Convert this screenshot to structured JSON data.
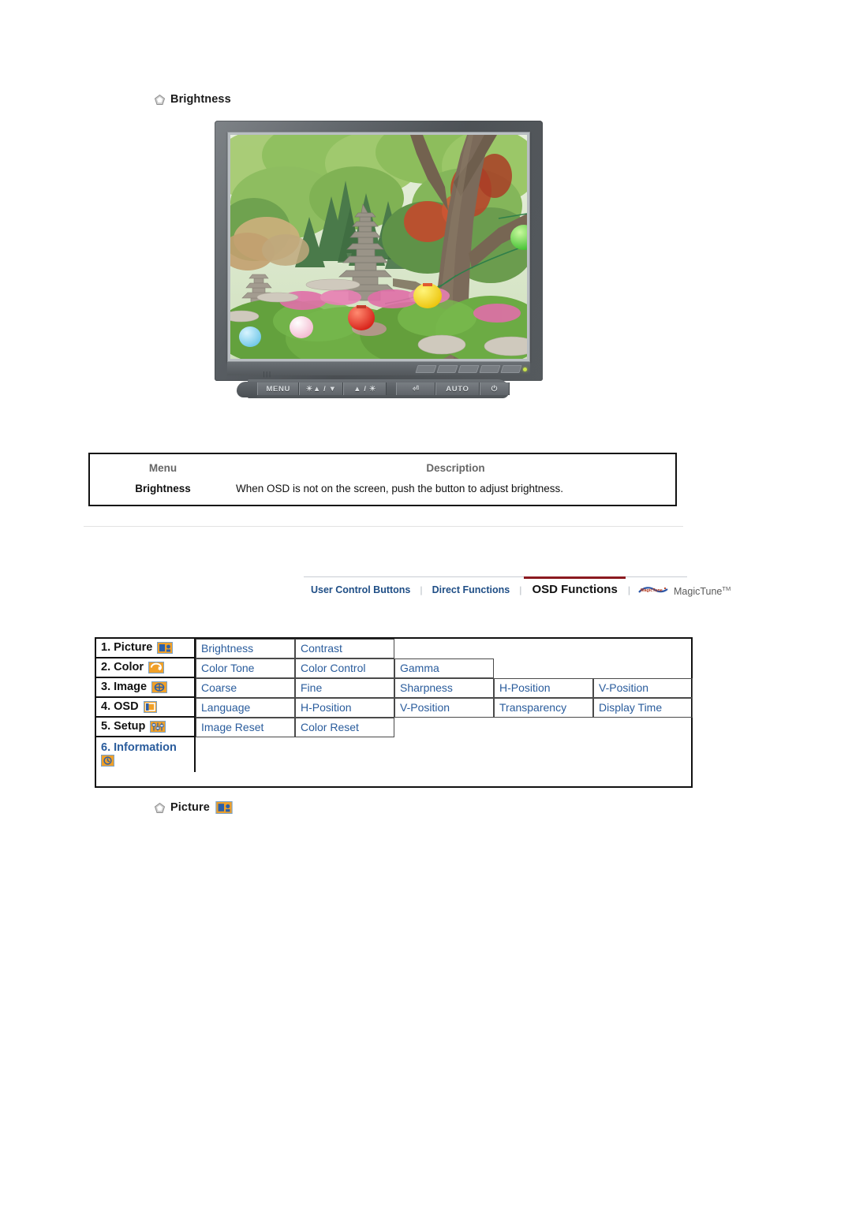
{
  "sections": {
    "brightness_heading": "Brightness",
    "picture_heading": "Picture"
  },
  "desc_table": {
    "headers": {
      "menu": "Menu",
      "description": "Description"
    },
    "rows": [
      {
        "menu": "Brightness",
        "description": "When OSD is not on the screen, push the button to adjust brightness."
      }
    ]
  },
  "monitor": {
    "buttons": [
      {
        "label": "MENU",
        "name": "menu-button"
      },
      {
        "label": "☀▲ / ▼",
        "name": "down-brightness-button"
      },
      {
        "label": "▲ / ☀",
        "name": "up-brightness-button"
      },
      {
        "label": "⏎",
        "name": "enter-button"
      },
      {
        "label": "AUTO",
        "name": "auto-button"
      },
      {
        "label": "⏻",
        "name": "power-button"
      }
    ]
  },
  "tabnav": {
    "tabs": [
      {
        "label": "User Control Buttons",
        "active": false
      },
      {
        "label": "Direct Functions",
        "active": false
      },
      {
        "label": "OSD Functions",
        "active": true
      }
    ],
    "separator": "❘",
    "magictune_label": "MagicTune",
    "magictune_tm": "TM",
    "active_underline_color": "#8b1a20",
    "link_color": "#1f4e86"
  },
  "osd_table": {
    "rows": [
      {
        "label": "1. Picture",
        "icon": "picture-icon",
        "items": [
          "Brightness",
          "Contrast"
        ]
      },
      {
        "label": "2. Color",
        "icon": "color-icon",
        "items": [
          "Color Tone",
          "Color Control",
          "Gamma"
        ]
      },
      {
        "label": "3. Image",
        "icon": "image-icon",
        "items": [
          "Coarse",
          "Fine",
          "Sharpness",
          "H-Position",
          "V-Position"
        ]
      },
      {
        "label": "4. OSD",
        "icon": "osd-icon",
        "items": [
          "Language",
          "H-Position",
          "V-Position",
          "Transparency",
          "Display Time"
        ]
      },
      {
        "label": "5. Setup",
        "icon": "setup-icon",
        "items": [
          "Image Reset",
          "Color Reset"
        ]
      },
      {
        "label": "6. Information",
        "icon": "information-icon",
        "items": []
      }
    ],
    "link_color": "#2a5c9c"
  },
  "colors": {
    "icon_orange": "#f0a028",
    "icon_border": "#7aa2c8",
    "bezel": "#b9bec2",
    "case": "#63686d"
  }
}
